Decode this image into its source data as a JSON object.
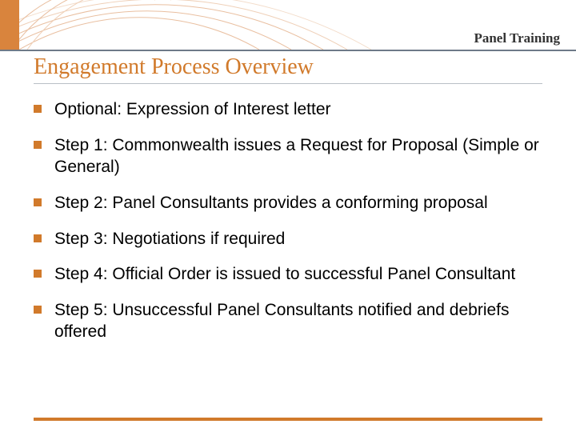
{
  "header": {
    "label": "Panel Training"
  },
  "title": "Engagement Process Overview",
  "bullets": [
    "Optional: Expression of Interest letter",
    "Step 1: Commonwealth issues a Request for Proposal (Simple or General)",
    "Step 2: Panel Consultants provides a conforming proposal",
    "Step 3: Negotiations if required",
    "Step 4: Official Order is issued to successful Panel Consultant",
    "Step 5: Unsuccessful Panel Consultants notified and debriefs offered"
  ]
}
